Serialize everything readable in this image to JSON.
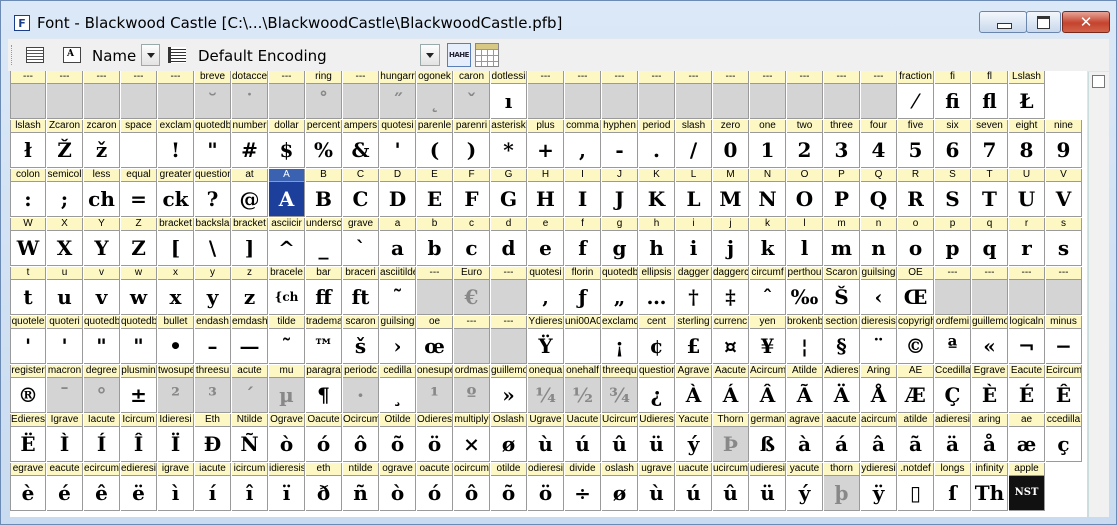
{
  "window": {
    "title": "Font - Blackwood Castle [C:\\...\\BlackwoodCastle\\BlackwoodCastle.pfb]",
    "app_icon": "F"
  },
  "toolbar": {
    "sort_label": "Name",
    "encoding_label": "Default Encoding",
    "hahe_label": "HAHE"
  },
  "icons": {
    "font_view": "list-icon",
    "glyph_props": "glyph-icon",
    "encoding": "encoding-icon",
    "metrics": "hahe-icon",
    "grid": "grid-icon"
  },
  "colors": {
    "name_bg": "#fcf7c3",
    "empty_cell": "#d4d4d4",
    "selected": "#1c3f9c"
  },
  "rows": [
    {
      "names": [
        "---",
        "---",
        "---",
        "---",
        "---",
        "breve",
        "dotacce",
        "---",
        "ring",
        "---",
        "hungarr",
        "ogonek",
        "caron",
        "dotlessi",
        "---",
        "---",
        "---",
        "---",
        "---",
        "---",
        "---",
        "---",
        "---",
        "---",
        "fraction",
        "fi",
        "fl",
        "Lslash"
      ],
      "glyphs": [
        "",
        "",
        "",
        "",
        "",
        "˘",
        "˙",
        "",
        "˚",
        "",
        "˝",
        "˛",
        "ˇ",
        "ı",
        "",
        "",
        "",
        "",
        "",
        "",
        "",
        "",
        "",
        "",
        "⁄",
        "fi",
        "fl",
        "Ł"
      ]
    },
    {
      "names": [
        "lslash",
        "Zcaron",
        "zcaron",
        "space",
        "exclam",
        "quotedb",
        "number",
        "dollar",
        "percent",
        "ampers",
        "quotesi",
        "parenle",
        "parenri",
        "asterisk",
        "plus",
        "comma",
        "hyphen",
        "period",
        "slash",
        "zero",
        "one",
        "two",
        "three",
        "four",
        "five",
        "six",
        "seven",
        "eight",
        "nine"
      ],
      "glyphs": [
        "ł",
        "Ž",
        "ž",
        "",
        "!",
        "\"",
        "#",
        "$",
        "%",
        "&",
        "'",
        "(",
        ")",
        "*",
        "+",
        ",",
        "-",
        ".",
        "/",
        "0",
        "1",
        "2",
        "3",
        "4",
        "5",
        "6",
        "7",
        "8",
        "9"
      ]
    },
    {
      "names": [
        "colon",
        "semicol",
        "less",
        "equal",
        "greater",
        "question",
        "at",
        "A",
        "B",
        "C",
        "D",
        "E",
        "F",
        "G",
        "H",
        "I",
        "J",
        "K",
        "L",
        "M",
        "N",
        "O",
        "P",
        "Q",
        "R",
        "S",
        "T",
        "U",
        "V"
      ],
      "glyphs": [
        ":",
        ";",
        "ch",
        "=",
        "ck",
        "?",
        "@",
        "A",
        "B",
        "C",
        "D",
        "E",
        "F",
        "G",
        "H",
        "I",
        "J",
        "K",
        "L",
        "M",
        "N",
        "O",
        "P",
        "Q",
        "R",
        "S",
        "T",
        "U",
        "V"
      ]
    },
    {
      "names": [
        "W",
        "X",
        "Y",
        "Z",
        "bracket",
        "backsla",
        "bracket",
        "asciicir",
        "undersc",
        "grave",
        "a",
        "b",
        "c",
        "d",
        "e",
        "f",
        "g",
        "h",
        "i",
        "j",
        "k",
        "l",
        "m",
        "n",
        "o",
        "p",
        "q",
        "r",
        "s"
      ],
      "glyphs": [
        "W",
        "X",
        "Y",
        "Z",
        "[",
        "\\",
        "]",
        "^",
        "_",
        "`",
        "a",
        "b",
        "c",
        "d",
        "e",
        "f",
        "g",
        "h",
        "i",
        "j",
        "k",
        "l",
        "m",
        "n",
        "o",
        "p",
        "q",
        "r",
        "s"
      ]
    },
    {
      "names": [
        "t",
        "u",
        "v",
        "w",
        "x",
        "y",
        "z",
        "bracele",
        "bar",
        "braceri",
        "asciitilde",
        "---",
        "Euro",
        "---",
        "quotesi",
        "florin",
        "quotedb",
        "ellipsis",
        "dagger",
        "daggerc",
        "circumf",
        "perthou",
        "Scaron",
        "guilsing",
        "OE",
        "---",
        "---",
        "---",
        "---"
      ],
      "glyphs": [
        "t",
        "u",
        "v",
        "w",
        "x",
        "y",
        "z",
        "{ch",
        "ff",
        "ft",
        "˜",
        "",
        "€",
        "",
        "‚",
        "ƒ",
        "„",
        "…",
        "†",
        "‡",
        "ˆ",
        "‰",
        "Š",
        "‹",
        "Œ",
        "",
        "",
        "",
        ""
      ]
    },
    {
      "names": [
        "quotele",
        "quoteri",
        "quotedb",
        "quotedb",
        "bullet",
        "endash",
        "emdash",
        "tilde",
        "tradema",
        "scaron",
        "guilsing",
        "oe",
        "---",
        "---",
        "Ydieres",
        "uni00A0",
        "exclamd",
        "cent",
        "sterling",
        "currenc",
        "yen",
        "brokenb",
        "section",
        "dieresis",
        "copyrigh",
        "ordfemi",
        "guillemo",
        "logicaln",
        "minus"
      ],
      "glyphs": [
        "'",
        "'",
        "\"",
        "\"",
        "•",
        "–",
        "—",
        "˜",
        "™",
        "š",
        "›",
        "œ",
        "",
        "",
        "Ÿ",
        "",
        "¡",
        "¢",
        "£",
        "¤",
        "¥",
        "¦",
        "§",
        "¨",
        "©",
        "ª",
        "«",
        "¬",
        "−"
      ]
    },
    {
      "names": [
        "register",
        "macron",
        "degree",
        "plusmin",
        "twosupe",
        "threesu",
        "acute",
        "mu",
        "paragra",
        "periodc",
        "cedilla",
        "onesupe",
        "ordmas",
        "guillemo",
        "onequa",
        "onehalf",
        "threequ",
        "question",
        "Agrave",
        "Aacute",
        "Acircum",
        "Atilde",
        "Adieres",
        "Aring",
        "AE",
        "Ccedilla",
        "Egrave",
        "Eacute",
        "Ecircum"
      ],
      "glyphs": [
        "®",
        "¯",
        "°",
        "±",
        "²",
        "³",
        "´",
        "µ",
        "¶",
        "·",
        "¸",
        "¹",
        "º",
        "»",
        "¼",
        "½",
        "¾",
        "¿",
        "À",
        "Á",
        "Â",
        "Ã",
        "Ä",
        "Å",
        "Æ",
        "Ç",
        "È",
        "É",
        "Ê"
      ]
    },
    {
      "names": [
        "Edieres",
        "Igrave",
        "Iacute",
        "Icircum",
        "Idieresi",
        "Eth",
        "Ntilde",
        "Ograve",
        "Oacute",
        "Ocircum",
        "Otilde",
        "Odieres",
        "multiply",
        "Oslash",
        "Ugrave",
        "Uacute",
        "Ucircum",
        "Udieres",
        "Yacute",
        "Thorn",
        "german",
        "agrave",
        "aacute",
        "acircum",
        "atilde",
        "adieresi",
        "aring",
        "ae",
        "ccedilla"
      ],
      "glyphs": [
        "Ë",
        "Ì",
        "Í",
        "Î",
        "Ï",
        "Ð",
        "Ñ",
        "ò",
        "ó",
        "ô",
        "õ",
        "ö",
        "×",
        "ø",
        "ù",
        "ú",
        "û",
        "ü",
        "ý",
        "Þ",
        "ß",
        "à",
        "á",
        "â",
        "ã",
        "ä",
        "å",
        "æ",
        "ç"
      ]
    },
    {
      "names": [
        "egrave",
        "eacute",
        "ecircum",
        "edieresi",
        "igrave",
        "iacute",
        "icircum",
        "idieresis",
        "eth",
        "ntilde",
        "ograve",
        "oacute",
        "ocircum",
        "otilde",
        "odieresi",
        "divide",
        "oslash",
        "ugrave",
        "uacute",
        "ucircum",
        "udieresi",
        "yacute",
        "thorn",
        "ydieresi",
        ".notdef",
        "longs",
        "infinity",
        "apple"
      ],
      "glyphs": [
        "è",
        "é",
        "ê",
        "ë",
        "ì",
        "í",
        "î",
        "ï",
        "ð",
        "ñ",
        "ò",
        "ó",
        "ô",
        "õ",
        "ö",
        "÷",
        "ø",
        "ù",
        "ú",
        "û",
        "ü",
        "ý",
        "þ",
        "ÿ",
        "▯",
        "ſ",
        "Th",
        "NST"
      ]
    }
  ],
  "dim_cells": {
    "0": [
      0,
      1,
      2,
      3,
      4,
      5,
      6,
      7,
      8,
      9,
      10,
      11,
      12,
      14,
      15,
      16,
      17,
      18,
      19,
      20,
      21,
      22,
      23
    ],
    "4": [
      11,
      12,
      13,
      25,
      26,
      27,
      28
    ],
    "5": [
      12,
      13
    ],
    "6": [
      1,
      2,
      4,
      5,
      6,
      7,
      9,
      11,
      12,
      14,
      15,
      16
    ],
    "7": [
      19
    ],
    "8": [
      22
    ]
  },
  "selected": {
    "row": 2,
    "col": 7
  }
}
